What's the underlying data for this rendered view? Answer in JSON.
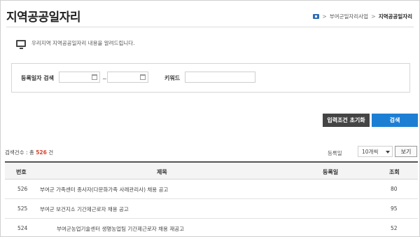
{
  "header": {
    "title": "지역공공일자리",
    "breadcrumb": {
      "home_icon": "home-icon",
      "parent": "부여군일자리사업",
      "separator": ">",
      "current": "지역공공일자리"
    }
  },
  "info": {
    "icon": "monitor-icon",
    "text": "우리지역 지역공공일자리 내용을 알려드립니다."
  },
  "search": {
    "date_label": "등록일자 검색",
    "date_from_value": "",
    "date_to_value": "",
    "date_separator": "~",
    "keyword_label": "키워드",
    "keyword_value": ""
  },
  "buttons": {
    "reset": "입력조건 초기화",
    "search": "검색"
  },
  "results": {
    "count_prefix": "검색건수 : 총",
    "count_value": "526",
    "count_suffix": "건",
    "sort_label": "등록일",
    "page_size": "10개씩",
    "view_button": "보기"
  },
  "table": {
    "headers": [
      "번호",
      "제목",
      "등록일",
      "조회"
    ],
    "rows": [
      {
        "no": "526",
        "title": "부여군 가족센터 종사자(다문화가족 사례관리사) 채용 공고",
        "date": "",
        "views": "80",
        "indent": false
      },
      {
        "no": "525",
        "title": "부여군 보건지소 기간제근로자 채용 공고",
        "date": "",
        "views": "95",
        "indent": false
      },
      {
        "no": "524",
        "title": "부여군농업기술센터 생명농업팀 기간제근로자 채용 재공고",
        "date": "",
        "views": "52",
        "indent": true
      }
    ]
  },
  "colors": {
    "accent": "#1c7fd4",
    "reset_button": "#444444",
    "count_highlight": "#d9432b"
  }
}
